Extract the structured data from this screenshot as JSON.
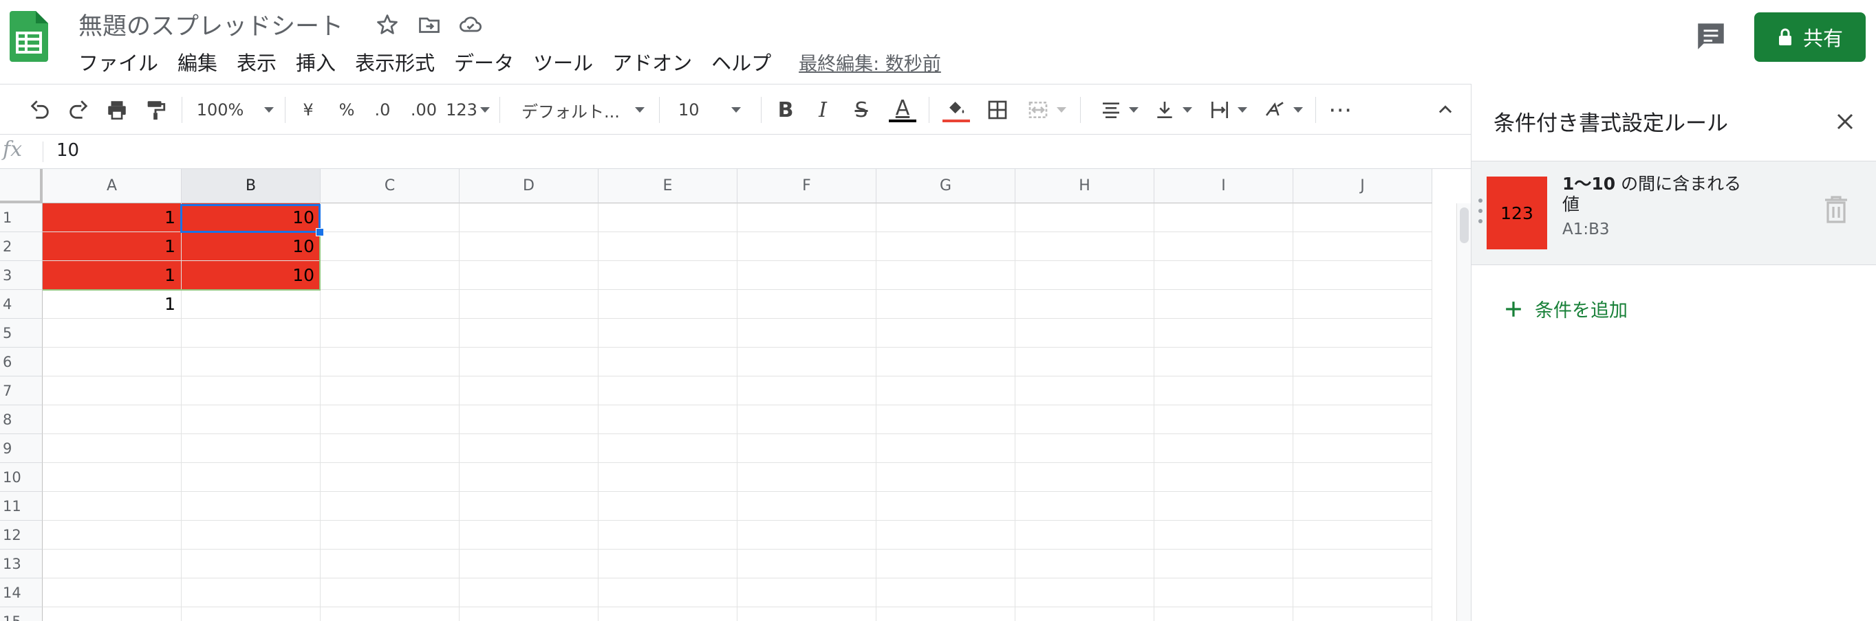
{
  "header": {
    "doc_title": "無題のスプレッドシート",
    "menus": [
      "ファイル",
      "編集",
      "表示",
      "挿入",
      "表示形式",
      "データ",
      "ツール",
      "アドオン",
      "ヘルプ"
    ],
    "last_edit": "最終編集: 数秒前",
    "share_label": "共有"
  },
  "toolbar": {
    "zoom": "100%",
    "currency": "¥",
    "percent": "%",
    "decimal_decrease": ".0",
    "decimal_increase": ".00",
    "number_format": "123",
    "font": "デフォルト...",
    "font_size": "10",
    "bold": "B",
    "italic": "I",
    "strike": "S",
    "text_color": "A",
    "more": "⋯"
  },
  "formula_bar": {
    "fx": "fx",
    "value": "10"
  },
  "grid": {
    "columns": [
      "A",
      "B",
      "C",
      "D",
      "E",
      "F",
      "G",
      "H",
      "I",
      "J"
    ],
    "rows": [
      "1",
      "2",
      "3",
      "4",
      "5",
      "6",
      "7",
      "8",
      "9",
      "10",
      "11",
      "12",
      "13",
      "14",
      "15"
    ],
    "cells": {
      "A1": "1",
      "B1": "10",
      "A2": "1",
      "B2": "10",
      "A3": "1",
      "B3": "10",
      "A4": "1"
    },
    "highlight_color": "#ea3323",
    "selection_color": "#1a73e8"
  },
  "panel": {
    "title": "条件付き書式設定ルール",
    "rule": {
      "preview_text": "123",
      "desc_bold": "1〜10",
      "desc_rest": " の間に含まれる値",
      "range": "A1:B3"
    },
    "add_rule_label": "条件を追加"
  },
  "colors": {
    "brand_green": "#188038",
    "rule_red": "#ea3323"
  }
}
